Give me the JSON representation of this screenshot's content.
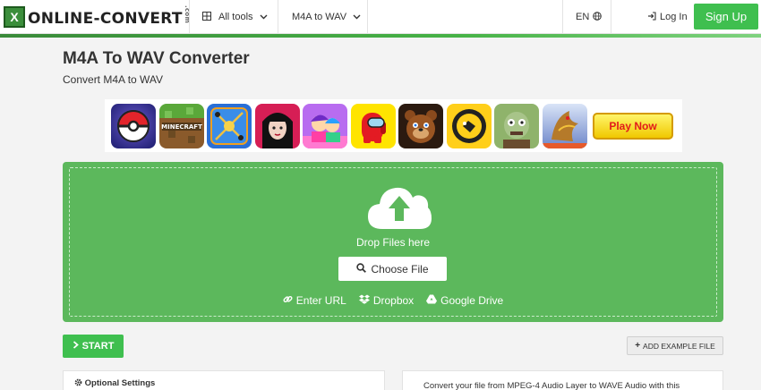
{
  "header": {
    "logo_text": "ONLINE-CONVERT",
    "logo_suffix": ".com",
    "logo_mark": "X",
    "all_tools_label": "All tools",
    "converter_label": "M4A to WAV",
    "language_label": "EN",
    "login_label": "Log In",
    "signup_label": "Sign Up"
  },
  "page": {
    "title": "M4A To WAV Converter",
    "subtitle": "Convert M4A to WAV"
  },
  "ad": {
    "play_now_label": "Play Now",
    "tiles": [
      "pokeball",
      "minecraft",
      "cue-ball",
      "vampire-girl",
      "pk-girl",
      "among-us",
      "freddy",
      "brawl-stars",
      "zombie",
      "dragon"
    ]
  },
  "upload": {
    "drop_text": "Drop Files here",
    "choose_label": "Choose File",
    "url_label": "Enter URL",
    "dropbox_label": "Dropbox",
    "drive_label": "Google Drive"
  },
  "actions": {
    "start_label": "START",
    "example_label": "ADD EXAMPLE FILE"
  },
  "panels": {
    "settings_label": "Optional Settings",
    "description": "Convert your file from MPEG-4 Audio Layer to WAVE Audio with this"
  },
  "colors": {
    "brand_green": "#3fbf4f",
    "drop_green": "#5cb85c"
  }
}
